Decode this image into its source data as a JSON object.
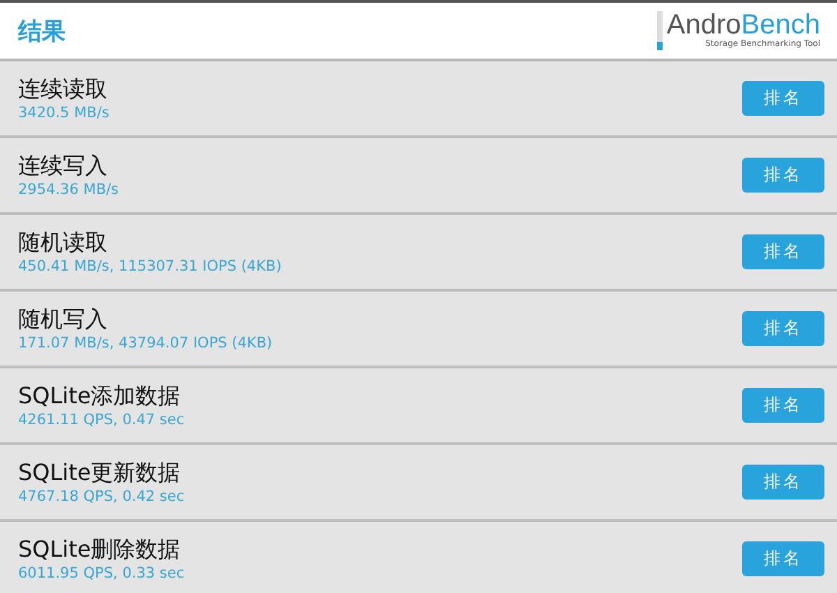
{
  "header": {
    "title": "结果",
    "logo": {
      "part_1": "Andro",
      "part_2": "Bench",
      "tagline": "Storage Benchmarking Tool"
    }
  },
  "results": [
    {
      "name": "连续读取",
      "value": "3420.5 MB/s",
      "button": "排名"
    },
    {
      "name": "连续写入",
      "value": "2954.36 MB/s",
      "button": "排名"
    },
    {
      "name": "随机读取",
      "value": "450.41 MB/s, 115307.31 IOPS (4KB)",
      "button": "排名"
    },
    {
      "name": "随机写入",
      "value": "171.07 MB/s, 43794.07 IOPS (4KB)",
      "button": "排名"
    },
    {
      "name": "SQLite添加数据",
      "value": "4261.11 QPS, 0.47 sec",
      "button": "排名"
    },
    {
      "name": "SQLite更新数据",
      "value": "4767.18 QPS, 0.42 sec",
      "button": "排名"
    },
    {
      "name": "SQLite删除数据",
      "value": "6011.95 QPS, 0.33 sec",
      "button": "排名"
    }
  ]
}
